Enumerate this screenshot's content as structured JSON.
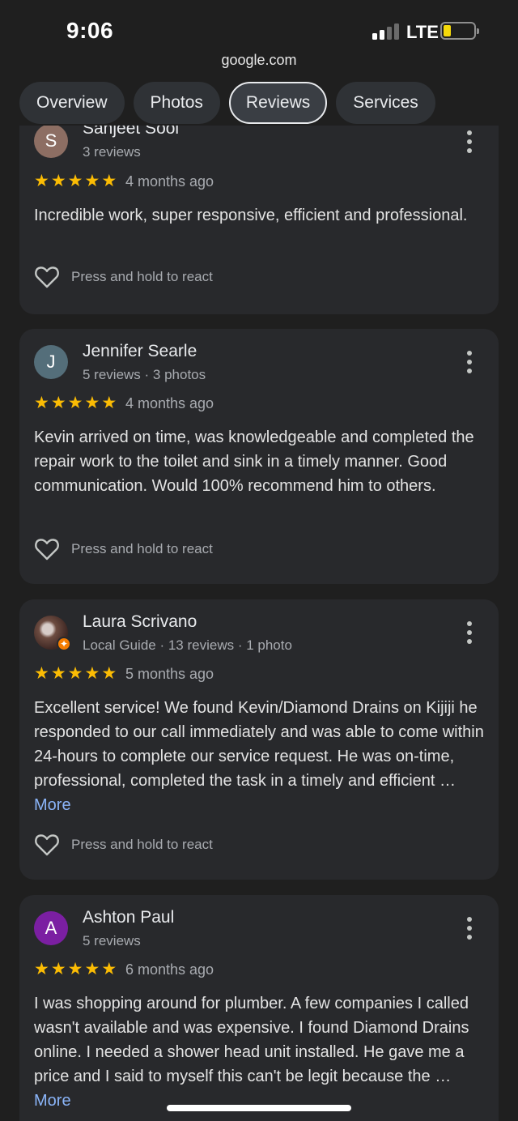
{
  "status": {
    "time": "9:06",
    "network": "LTE",
    "battery_level": 0.2,
    "battery_color": "#f5d90a"
  },
  "url": "google.com",
  "tabs": [
    {
      "label": "Overview",
      "active": false
    },
    {
      "label": "Photos",
      "active": false
    },
    {
      "label": "Reviews",
      "active": true
    },
    {
      "label": "Services",
      "active": false
    }
  ],
  "reviews": [
    {
      "name": "Sanjeet Sool",
      "avatar_letter": "S",
      "avatar_color": "#8d6e63",
      "meta": "3 reviews",
      "rating": 5,
      "time_ago": "4 months ago",
      "text": "Incredible work, super responsive, efficient and professional.",
      "react_label": "Press and hold to react"
    },
    {
      "name": "Jennifer Searle",
      "avatar_letter": "J",
      "avatar_color": "#546e7a",
      "meta": "5 reviews · 3 photos",
      "rating": 5,
      "time_ago": "4 months ago",
      "text": "Kevin arrived on time, was knowledgeable and completed the repair work to the toilet and sink in a timely manner. Good communication. Would 100% recommend him to others.",
      "react_label": "Press and hold to react"
    },
    {
      "name": "Laura Scrivano",
      "avatar_letter": "",
      "avatar_color": "#5d4037",
      "meta": "Local Guide · 13 reviews · 1 photo",
      "rating": 5,
      "time_ago": "5 months ago",
      "text": "Excellent service! We found Kevin/Diamond Drains on Kijiji he responded to our call immediately and was able to come within 24-hours to complete our service request. He was on-time, professional, completed the task in a timely and efficient … ",
      "more_label": "More",
      "react_label": "Press and hold to react"
    },
    {
      "name": "Ashton Paul",
      "avatar_letter": "A",
      "avatar_color": "#7b1fa2",
      "meta": "5 reviews",
      "rating": 5,
      "time_ago": "6 months ago",
      "text": "I was shopping around for plumber. A few companies I called wasn't available and was expensive. I found Diamond Drains online. I needed a shower head unit installed. He gave me a price and I said to myself this can't be legit because the … ",
      "more_label": "More"
    }
  ],
  "icons": {
    "star": "star-icon",
    "heart": "heart-outline-icon",
    "overflow": "more-vert-icon"
  }
}
